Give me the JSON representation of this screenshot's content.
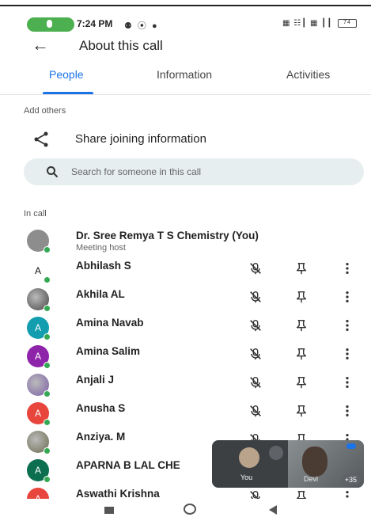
{
  "status_bar": {
    "time": "7:24 PM",
    "left_icons": "⚉ ⦿ ●",
    "right_icons": "▦ ☷┃ ▦ ┃┃",
    "battery": "74"
  },
  "header": {
    "title": "About this call"
  },
  "tabs": [
    {
      "label": "People",
      "active": true
    },
    {
      "label": "Information",
      "active": false
    },
    {
      "label": "Activities",
      "active": false
    }
  ],
  "add_others": {
    "label": "Add others",
    "share_label": "Share joining information"
  },
  "search": {
    "placeholder": "Search for someone in this call"
  },
  "in_call": {
    "label": "In call",
    "host": {
      "name": "Dr. Sree Remya T S Chemistry (You)",
      "role": "Meeting host"
    },
    "participants": [
      {
        "name": "Abhilash S",
        "initial": "A",
        "color": "#ffffff",
        "kind": "photo-sign"
      },
      {
        "name": "Akhila AL",
        "initial": "",
        "color": "#444444",
        "kind": "photo"
      },
      {
        "name": "Amina Navab",
        "initial": "A",
        "color": "#129eaf",
        "kind": "letter"
      },
      {
        "name": "Amina Salim",
        "initial": "A",
        "color": "#8e24aa",
        "kind": "letter"
      },
      {
        "name": "Anjali J",
        "initial": "",
        "color": "#7b5ea7",
        "kind": "photo"
      },
      {
        "name": "Anusha S",
        "initial": "A",
        "color": "#e8453c",
        "kind": "letter"
      },
      {
        "name": "Anziya. M",
        "initial": "",
        "color": "#6b6b4f",
        "kind": "photo"
      },
      {
        "name": "APARNA B LAL CHE",
        "initial": "A",
        "color": "#0b6e4f",
        "kind": "letter"
      },
      {
        "name": "Aswathi Krishna",
        "initial": "A",
        "color": "#e8453c",
        "kind": "letter"
      }
    ]
  },
  "tiles": {
    "you_label": "You",
    "other_name": "Devi",
    "count": "+35"
  },
  "colors": {
    "accent": "#1a73e8",
    "online": "#34a853"
  }
}
